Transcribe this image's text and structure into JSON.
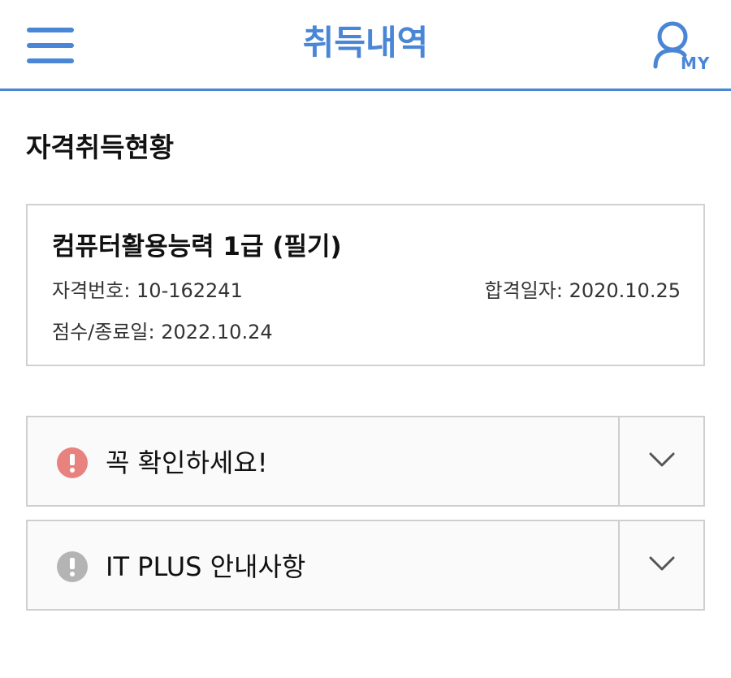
{
  "header": {
    "title": "취득내역",
    "my_label": "MY",
    "accent_color": "#4a86d6",
    "menu_icon": "hamburger-menu-icon",
    "my_icon": "user-icon"
  },
  "section": {
    "title": "자격취득현황"
  },
  "certificate": {
    "name": "컴퓨터활용능력 1급 (필기)",
    "number_text": "자격번호: 10-162241",
    "pass_date_text": "합격일자: 2020.10.25",
    "score_end_text": "점수/종료일: 2022.10.24"
  },
  "accordions": [
    {
      "label": "꼭 확인하세요!",
      "icon": "alert-circle-icon",
      "icon_color": "#e8827e",
      "toggle_icon": "chevron-down-icon"
    },
    {
      "label": "IT PLUS 안내사항",
      "icon": "alert-circle-icon",
      "icon_color": "#b4b4b4",
      "toggle_icon": "chevron-down-icon"
    }
  ]
}
